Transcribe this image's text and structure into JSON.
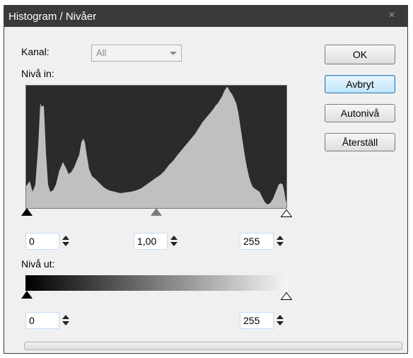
{
  "window": {
    "title": "Histogram / Nivåer",
    "close_glyph": "×",
    "close_icon": "close-icon"
  },
  "channel": {
    "label": "Kanal:",
    "value": "All"
  },
  "input_levels": {
    "label": "Nivå in:",
    "black": "0",
    "gamma": "1,00",
    "white": "255"
  },
  "output_levels": {
    "label": "Nivå ut:",
    "black": "0",
    "white": "255"
  },
  "buttons": {
    "ok": "OK",
    "cancel": "Avbryt",
    "auto": "Autonivå",
    "reset": "Återställ"
  },
  "colors": {
    "histogram_bg": "#2b2b2b",
    "histogram_fill": "#c0c0c0",
    "titlebar": "#3a3a3a",
    "default_button": "#bee6fd"
  }
}
